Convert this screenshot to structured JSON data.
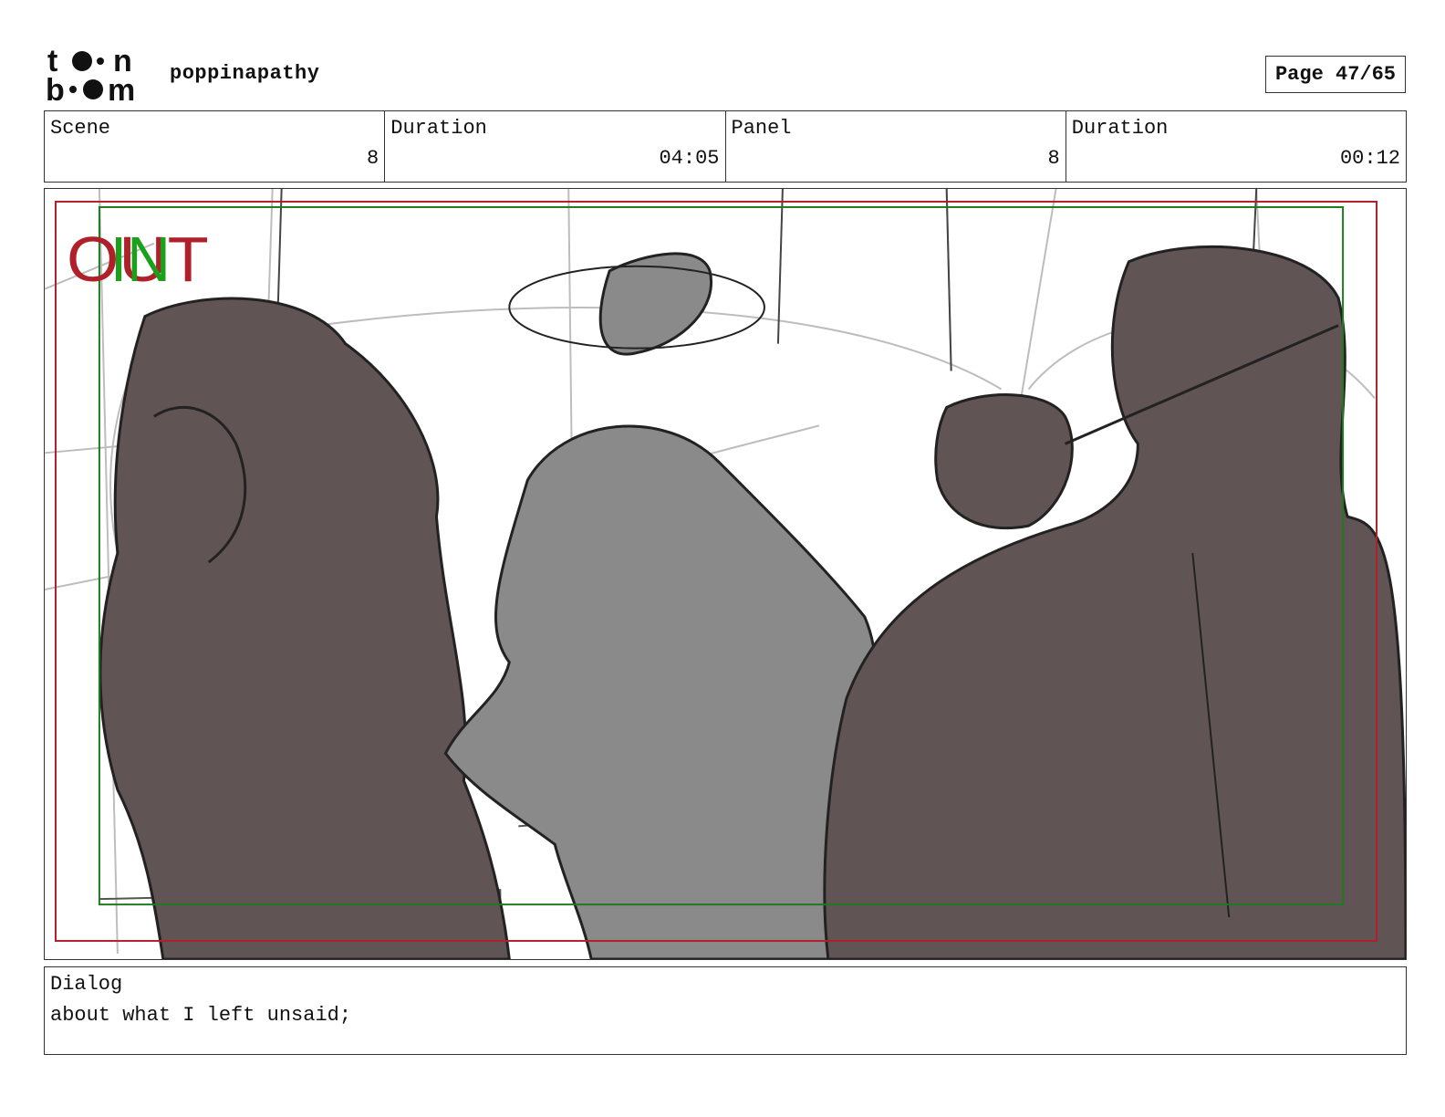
{
  "header": {
    "logo_text_top": "toon",
    "logo_text_bottom": "boom",
    "project_title": "poppinapathy",
    "page_indicator": "Page 47/65"
  },
  "info": {
    "scene_label": "Scene",
    "scene_value": "8",
    "scene_duration_label": "Duration",
    "scene_duration_value": "04:05",
    "panel_label": "Panel",
    "panel_value": "8",
    "panel_duration_label": "Duration",
    "panel_duration_value": "00:12"
  },
  "panel": {
    "overlay_out": "OUT",
    "overlay_in": "IN",
    "colors": {
      "safe_frame_red": "#b0202a",
      "safe_frame_green": "#1f7a1f",
      "character_dark": "#615454",
      "character_light": "#8a8a8a"
    }
  },
  "dialog": {
    "label": "Dialog",
    "text": "about what I left unsaid;"
  }
}
